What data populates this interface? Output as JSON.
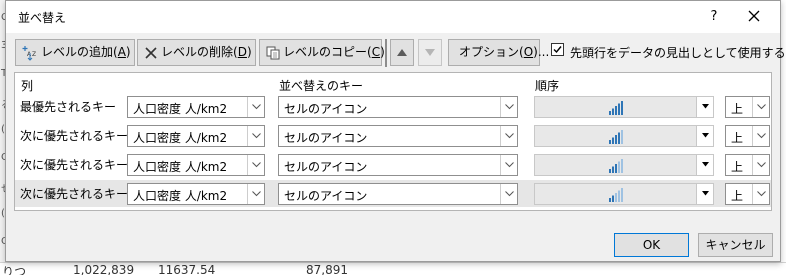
{
  "dialog": {
    "title": "並べ替え",
    "help_label": "?"
  },
  "toolbar": {
    "add_level": {
      "label": "レベルの追加(",
      "key": "A",
      "suffix": ")"
    },
    "delete_level": {
      "label": "レベルの削除(",
      "key": "D",
      "suffix": ")"
    },
    "copy_level": {
      "label": "レベルのコピー(",
      "key": "C",
      "suffix": ")"
    },
    "options": {
      "label": "オプション(",
      "key": "O",
      "suffix": ")..."
    },
    "has_header": {
      "label": "先頭行をデータの見出しとして使用する(",
      "key": "H",
      "suffix": ")",
      "checked": true
    }
  },
  "columns": {
    "column": "列",
    "sort_on": "並べ替えのキー",
    "order": "順序"
  },
  "levels": [
    {
      "label": "最優先されるキー",
      "column": "人口密度 人/km2",
      "sort_on": "セルのアイコン",
      "icon": "bar-signal-icon",
      "order": "上"
    },
    {
      "label": "次に優先されるキー",
      "column": "人口密度 人/km2",
      "sort_on": "セルのアイコン",
      "icon": "bar-signal-icon",
      "order": "上"
    },
    {
      "label": "次に優先されるキー",
      "column": "人口密度 人/km2",
      "sort_on": "セルのアイコン",
      "icon": "bar-signal-icon",
      "order": "上"
    },
    {
      "label": "次に優先されるキー",
      "column": "人口密度 人/km2",
      "sort_on": "セルのアイコン",
      "icon": "bar-signal-icon",
      "order": "上"
    }
  ],
  "footer": {
    "ok": "OK",
    "cancel": "キャンセル"
  },
  "background": {
    "left_strip": [
      "C",
      "3",
      "T",
      "る",
      "(",
      "O",
      "せ",
      "(",
      "O"
    ],
    "bottom_row": [
      "りつ",
      "1,022,839",
      "11637.54",
      "87,891"
    ]
  },
  "colors": {
    "accent": "#0078d7",
    "icon_blue": "#2e75b6",
    "selected_row": "#e6e6e6"
  }
}
